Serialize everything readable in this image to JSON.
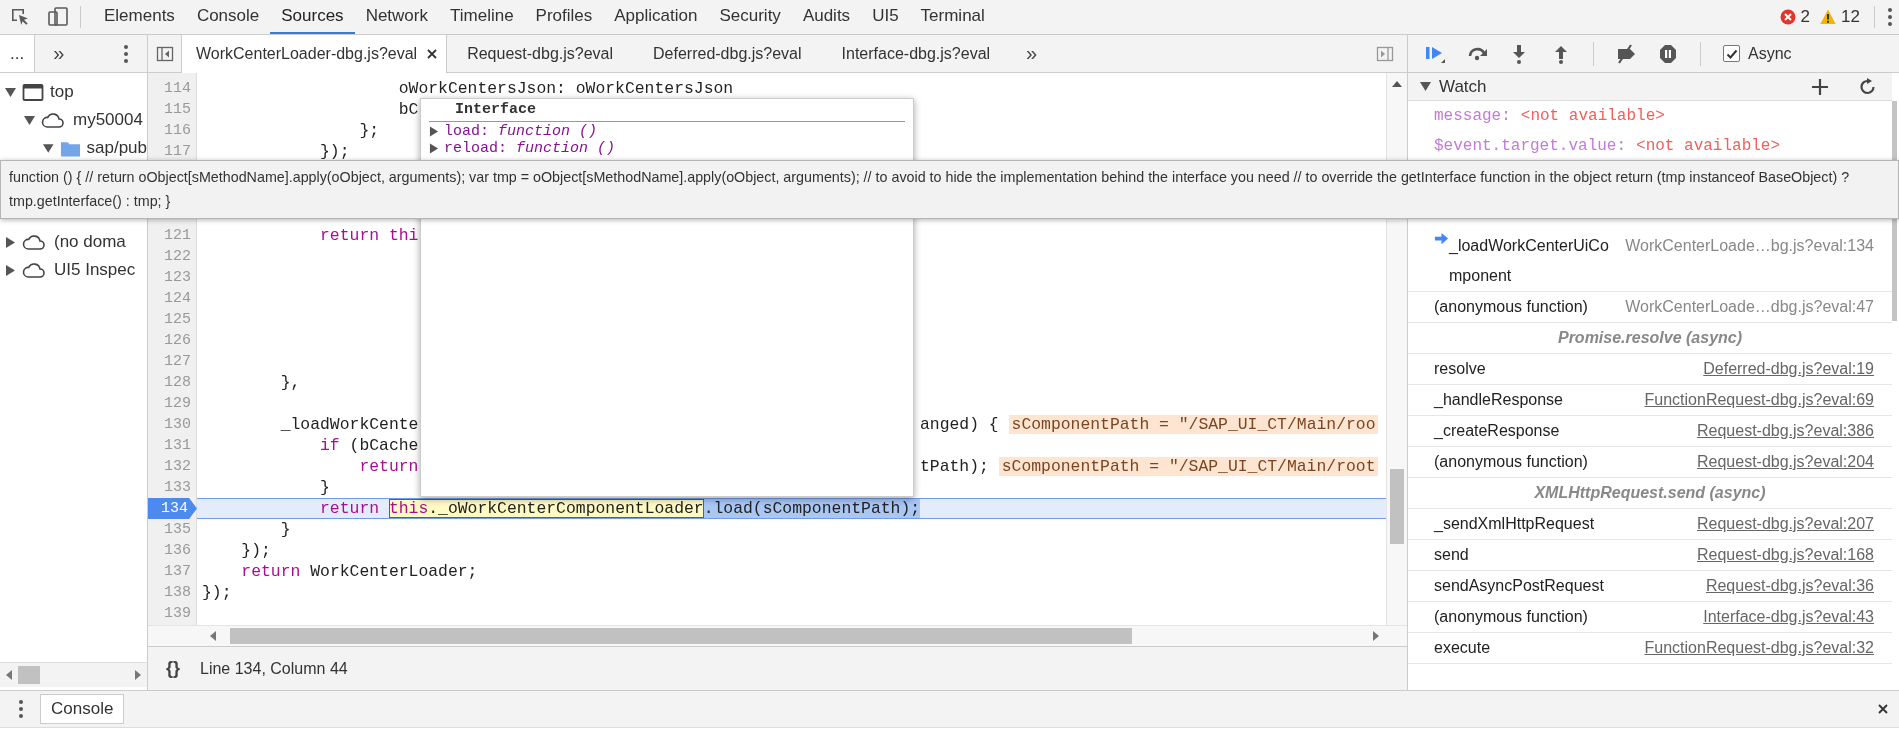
{
  "toolbar": {
    "tabs": [
      {
        "label": "Elements",
        "selected": false
      },
      {
        "label": "Console",
        "selected": false
      },
      {
        "label": "Sources",
        "selected": true
      },
      {
        "label": "Network",
        "selected": false
      },
      {
        "label": "Timeline",
        "selected": false
      },
      {
        "label": "Profiles",
        "selected": false
      },
      {
        "label": "Application",
        "selected": false
      },
      {
        "label": "Security",
        "selected": false
      },
      {
        "label": "Audits",
        "selected": false
      },
      {
        "label": "UI5",
        "selected": false
      },
      {
        "label": "Terminal",
        "selected": false
      }
    ],
    "errors": "2",
    "warnings": "12"
  },
  "navigator": {
    "tabs": [
      {
        "label": "...",
        "selected": true
      }
    ],
    "more": "»",
    "tree": [
      {
        "label": "top",
        "kind": "frame",
        "expanded": true,
        "children": [
          {
            "label": "my50004",
            "kind": "domain",
            "expanded": true,
            "children": [
              {
                "label": "sap/pub",
                "kind": "folder",
                "expanded": true
              }
            ]
          }
        ]
      },
      {
        "label": "(no doma",
        "kind": "domain",
        "expanded": false
      },
      {
        "label": "UI5 Inspec",
        "kind": "domain",
        "expanded": false
      }
    ]
  },
  "editor": {
    "tabs": [
      {
        "label": "WorkCenterLoader-dbg.js?eval",
        "selected": true
      },
      {
        "label": "Request-dbg.js?eval",
        "selected": false
      },
      {
        "label": "Deferred-dbg.js?eval",
        "selected": false
      },
      {
        "label": "Interface-dbg.js?eval",
        "selected": false
      }
    ],
    "more": "»",
    "lines": [
      {
        "number": "114",
        "kind": "normal",
        "segments": [
          {
            "kind": "plain",
            "text": "                    oWorkCentersJson: oWorkCentersJson"
          }
        ]
      },
      {
        "number": "115",
        "kind": "normal",
        "segments": [
          {
            "kind": "plain",
            "text": "                    bC"
          }
        ]
      },
      {
        "number": "116",
        "kind": "normal",
        "segments": [
          {
            "kind": "plain",
            "text": "                };"
          }
        ]
      },
      {
        "number": "117",
        "kind": "normal",
        "segments": [
          {
            "kind": "plain",
            "text": "            });"
          }
        ]
      },
      {
        "number": "121",
        "kind": "normal",
        "segments": [
          {
            "kind": "keyword",
            "text": "            return thi"
          }
        ]
      },
      {
        "number": "122",
        "kind": "normal"
      },
      {
        "number": "123",
        "kind": "normal"
      },
      {
        "number": "124",
        "kind": "normal"
      },
      {
        "number": "125",
        "kind": "normal"
      },
      {
        "number": "126",
        "kind": "normal"
      },
      {
        "number": "127",
        "kind": "normal"
      },
      {
        "number": "128",
        "kind": "normal",
        "segments": [
          {
            "kind": "plain",
            "text": "        },"
          }
        ]
      },
      {
        "number": "129",
        "kind": "normal"
      },
      {
        "number": "130",
        "kind": "normal",
        "segments": [
          {
            "kind": "plain",
            "text": "        _loadWorkCente"
          }
        ],
        "suffix": "anged) {",
        "inline_value": "sComponentPath = \"/SAP_UI_CT/Main/roo"
      },
      {
        "number": "131",
        "kind": "normal",
        "segments": [
          {
            "kind": "keyword",
            "text": "            if"
          },
          {
            "kind": "plain",
            "text": " (bCache"
          }
        ]
      },
      {
        "number": "132",
        "kind": "normal",
        "segments": [
          {
            "kind": "keyword",
            "text": "                return"
          }
        ],
        "suffix": "tPath);",
        "inline_value": "sComponentPath = \"/SAP_UI_CT/Main/root"
      },
      {
        "number": "133",
        "kind": "normal",
        "segments": [
          {
            "kind": "plain",
            "text": "            }"
          }
        ]
      },
      {
        "number": "134",
        "kind": "paused",
        "segments": [
          {
            "kind": "keyword",
            "text": "            return "
          },
          {
            "kind": "hover",
            "segments": [
              {
                "kind": "keyword",
                "text": "this"
              },
              {
                "kind": "plain",
                "text": "._oWorkCenterComponentLoader"
              }
            ]
          },
          {
            "kind": "selection",
            "text": ".load(sComponentPath);"
          }
        ]
      },
      {
        "number": "135",
        "kind": "normal",
        "segments": [
          {
            "kind": "plain",
            "text": "        }"
          }
        ]
      },
      {
        "number": "136",
        "kind": "normal",
        "segments": [
          {
            "kind": "plain",
            "text": "    });"
          }
        ]
      },
      {
        "number": "137",
        "kind": "normal",
        "segments": [
          {
            "kind": "keyword",
            "text": "    return"
          },
          {
            "kind": "plain",
            "text": " WorkCenterLoader;"
          }
        ]
      },
      {
        "number": "138",
        "kind": "normal",
        "segments": [
          {
            "kind": "plain",
            "text": "});"
          }
        ]
      },
      {
        "number": "139",
        "kind": "normal"
      }
    ],
    "popover": {
      "title": "Interface",
      "properties": [
        {
          "label": "load: *function ()*",
          "expanded": false
        },
        {
          "label": "reload: *function ()*",
          "expanded": false
        }
      ]
    },
    "status": {
      "format": "{}",
      "position": "Line 134, Column 44"
    }
  },
  "tooltip": {
    "text": "function () { // return oObject[sMethodName].apply(oObject, arguments); var tmp = oObject[sMethodName].apply(oObject, arguments); // to avoid to hide the implementation behind the interface you need // to override the getInterface function in the object return (tmp instanceof BaseObject) ? tmp.getInterface() : tmp; }"
  },
  "debugger": {
    "async": {
      "label": "Async",
      "checked": true
    },
    "watch": {
      "title": "Watch",
      "expanded": true,
      "items": [
        {
          "name": "message:",
          "value": "<not available>"
        },
        {
          "name": "$event.target.value:",
          "value": "<not available>"
        }
      ]
    },
    "call_stack": [
      {
        "kind": "frame",
        "name": "_loadWorkCenterUiComponent",
        "location": "WorkCenterLoade…bg.js?eval:134",
        "current": true,
        "linked": false
      },
      {
        "kind": "frame",
        "name": "(anonymous function)",
        "location": "WorkCenterLoade…dbg.js?eval:47",
        "current": false,
        "linked": false
      },
      {
        "kind": "async",
        "label": "Promise.resolve (async)"
      },
      {
        "kind": "frame",
        "name": "resolve",
        "location": "Deferred-dbg.js?eval:19",
        "current": false,
        "linked": true
      },
      {
        "kind": "frame",
        "name": "_handleResponse",
        "location": "FunctionRequest-dbg.js?eval:69",
        "current": false,
        "linked": true
      },
      {
        "kind": "frame",
        "name": "_createResponse",
        "location": "Request-dbg.js?eval:386",
        "current": false,
        "linked": true
      },
      {
        "kind": "frame",
        "name": "(anonymous function)",
        "location": "Request-dbg.js?eval:204",
        "current": false,
        "linked": true
      },
      {
        "kind": "async",
        "label": "XMLHttpRequest.send (async)"
      },
      {
        "kind": "frame",
        "name": "_sendXmlHttpRequest",
        "location": "Request-dbg.js?eval:207",
        "current": false,
        "linked": true
      },
      {
        "kind": "frame",
        "name": "send",
        "location": "Request-dbg.js?eval:168",
        "current": false,
        "linked": true
      },
      {
        "kind": "frame",
        "name": "sendAsyncPostRequest",
        "location": "Request-dbg.js?eval:36",
        "current": false,
        "linked": true
      },
      {
        "kind": "frame",
        "name": "(anonymous function)",
        "location": "Interface-dbg.js?eval:43",
        "current": false,
        "linked": true
      },
      {
        "kind": "frame",
        "name": "execute",
        "location": "FunctionRequest-dbg.js?eval:32",
        "current": false,
        "linked": true
      }
    ]
  },
  "drawer": {
    "tabs": [
      {
        "label": "Console",
        "selected": true
      }
    ]
  }
}
